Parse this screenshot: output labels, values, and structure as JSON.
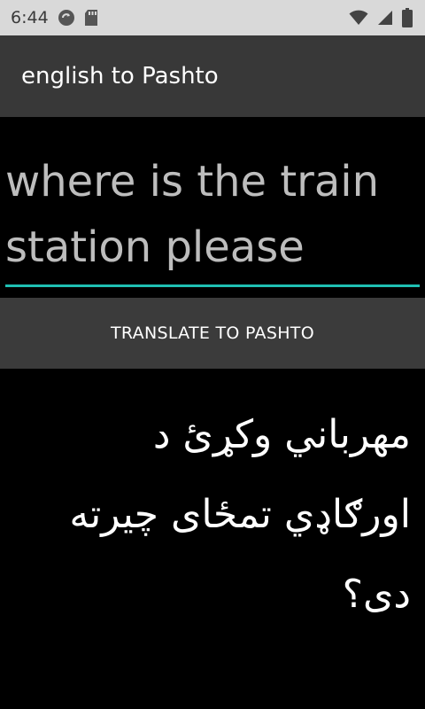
{
  "status_bar": {
    "time": "6:44",
    "left_icons": [
      "sync-icon",
      "sd-card-icon"
    ],
    "right_icons": [
      "wifi-icon",
      "signal-icon",
      "battery-icon"
    ]
  },
  "app_bar": {
    "title": "english to Pashto"
  },
  "input": {
    "value": "where is the train station please"
  },
  "translate_button": {
    "label": "TRANSLATE TO PASHTO"
  },
  "output": {
    "text": "مهرباني وکړئ د اورګاډي تمځای چیرته دی؟"
  },
  "colors": {
    "accent": "#1fc0b3",
    "status_bar_bg": "#d9d9d9",
    "app_bar_bg": "#383838",
    "button_bg": "#3b3b3b",
    "background": "#000000"
  }
}
